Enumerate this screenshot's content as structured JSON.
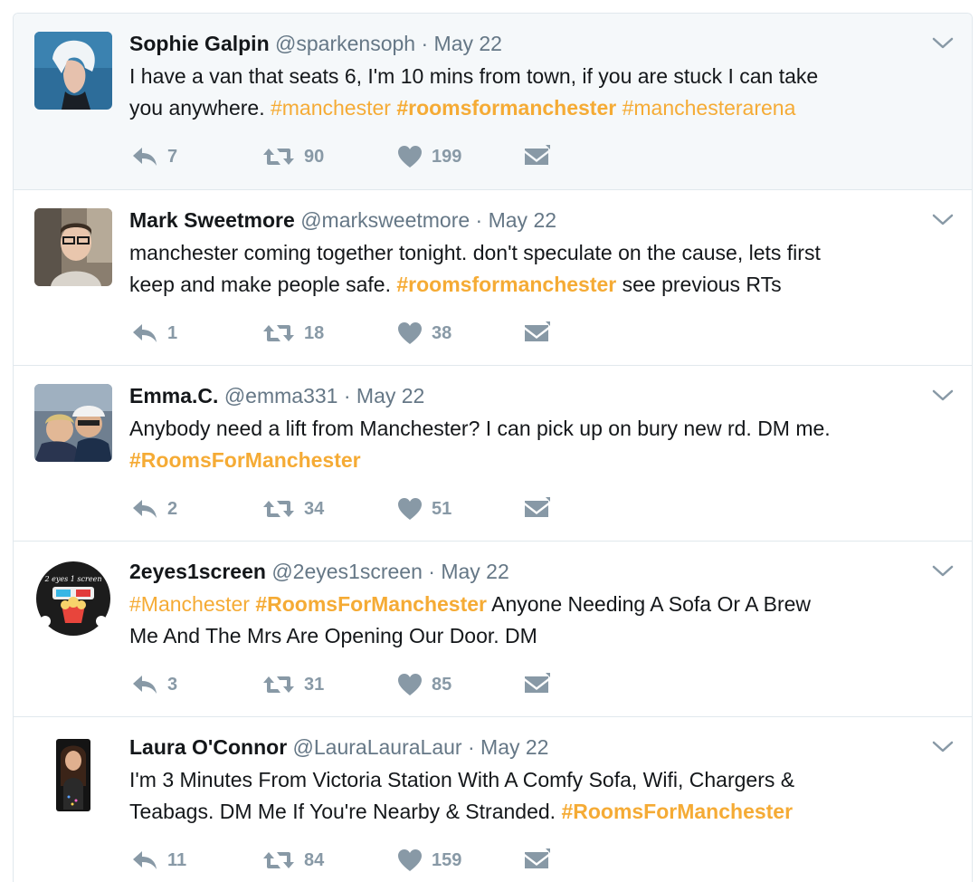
{
  "colors": {
    "hashtag": "#f5ab35",
    "meta": "#657786",
    "action": "#8899a6",
    "highlight_bg": "#f5f8fa",
    "border": "#e1e8ed"
  },
  "icons": {
    "reply": "reply-icon",
    "retweet": "retweet-icon",
    "like": "heart-icon",
    "dm": "envelope-icon",
    "more": "chevron-down-icon"
  },
  "tweets": [
    {
      "name": "Sophie Galpin",
      "handle": "@sparkensoph",
      "date": "May 22",
      "text_1": "I have a van that seats 6, I'm 10 mins from town, if you are stuck I can take",
      "text_2": "you anywhere. ",
      "tag_1": "#manchester",
      "tag_2": "#roomsformanchester",
      "tag_3": "#manchesterarena",
      "replies": "7",
      "retweets": "90",
      "likes": "199"
    },
    {
      "name": "Mark Sweetmore",
      "handle": "@marksweetmore",
      "date": "May 22",
      "text_1": "manchester coming together tonight. don't speculate on the cause, lets first",
      "text_2": "keep and make people safe. ",
      "tag_1": "#roomsformanchester",
      "text_3": " see previous RTs",
      "replies": "1",
      "retweets": "18",
      "likes": "38"
    },
    {
      "name": "Emma.C.",
      "handle": "@emma331",
      "date": "May 22",
      "text_1": "Anybody need a lift from Manchester? I can pick up on bury new rd. DM me.",
      "tag_1": "#RoomsForManchester",
      "replies": "2",
      "retweets": "34",
      "likes": "51"
    },
    {
      "name": "2eyes1screen",
      "handle": "@2eyes1screen",
      "date": "May 22",
      "tag_1": "#Manchester",
      "tag_2": "#RoomsForManchester",
      "text_1": " Anyone Needing A Sofa Or A Brew",
      "text_2": "Me And The Mrs Are Opening Our Door. DM",
      "avatar_text": "2 eyes 1 screen",
      "replies": "3",
      "retweets": "31",
      "likes": "85"
    },
    {
      "name": "Laura O'Connor",
      "handle": "@LauraLauraLaur",
      "date": "May 22",
      "text_1": "I'm 3 Minutes From Victoria Station With A Comfy Sofa, Wifi, Chargers &",
      "text_2": "Teabags. DM Me If You're Nearby & Stranded. ",
      "tag_1": "#RoomsForManchester",
      "replies": "11",
      "retweets": "84",
      "likes": "159"
    }
  ]
}
